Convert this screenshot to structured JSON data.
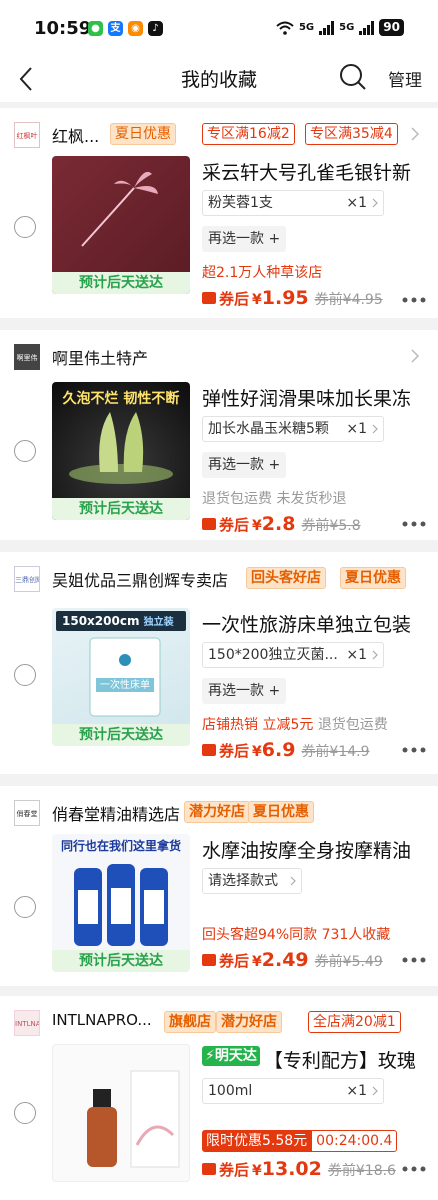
{
  "status": {
    "time": "10:59",
    "network1": "5G",
    "network2": "5G",
    "battery": "90"
  },
  "nav": {
    "title": "我的收藏",
    "manage": "管理"
  },
  "items": [
    {
      "shop": {
        "logo_text": "红枫叶",
        "name": "红枫...",
        "tags": [
          "夏日优惠",
          "专区满16减2",
          "专区满35减4"
        ]
      },
      "title": "采云轩大号孔雀毛银针新",
      "sku": "粉芙蓉1支",
      "qty": "×1",
      "again": "再选一款 +",
      "ship": "预计后天送达",
      "promo": "超2.1万人种草该店",
      "after_label": "券后",
      "yen": "¥",
      "price": "1.95",
      "before": "券前¥4.95"
    },
    {
      "shop": {
        "logo_text": "啊里伟",
        "name": "啊里伟土特产",
        "tags": []
      },
      "title": "弹性好润滑果味加长果冻",
      "image_text": "久泡不烂  韧性不断",
      "sku": "加长水晶玉米糖5颗",
      "qty": "×1",
      "again": "再选一款 +",
      "ship": "预计后天送达",
      "promo": "退货包运费  未发货秒退",
      "after_label": "券后",
      "yen": "¥",
      "price": "2.8",
      "before": "券前¥5.8"
    },
    {
      "shop": {
        "logo_text": "三鼎创辉",
        "name": "吴姐优品三鼎创辉专卖店",
        "tags": [
          "回头客好店",
          "夏日优惠"
        ]
      },
      "title": "一次性旅游床单独立包装",
      "image_text": "150x200cm",
      "image_text2": "独立装",
      "image_text3": "一次性床单",
      "sku": "150*200独立灭菌...",
      "qty": "×1",
      "again": "再选一款 +",
      "ship": "预计后天送达",
      "promo_red": "店铺热销  立减5元",
      "promo_gray": "退货包运费",
      "after_label": "券后",
      "yen": "¥",
      "price": "6.9",
      "before": "券前¥14.9"
    },
    {
      "shop": {
        "logo_text": "俏春堂",
        "name": "俏春堂精油精选店",
        "tags": [
          "潜力好店",
          "夏日优惠"
        ]
      },
      "title": "水摩油按摩全身按摩精油",
      "image_text": "同行也在我们这里拿货",
      "sku": "请选择款式",
      "ship": "预计后天送达",
      "promo": "回头客超94%同款  731人收藏",
      "after_label": "券后",
      "yen": "¥",
      "price": "2.49",
      "before": "券前¥5.49"
    },
    {
      "shop": {
        "logo_text": "INTLNA",
        "name": "INTLNAPRO...",
        "tags": [
          "旗舰店",
          "潜力好店",
          "全店满20减1"
        ]
      },
      "flash": "明天达",
      "title": "【专利配方】玫瑰",
      "sku": "100ml",
      "qty": "×1",
      "limit_a": "限时优惠5.58元",
      "limit_b": "00:24:00.4",
      "after_label": "券后",
      "yen": "¥",
      "price": "13.02",
      "before": "券前¥18.6"
    }
  ],
  "colors": {
    "accent": "#e4380f",
    "ship_green": "#2aa14d",
    "tag_orange": "#e55f00"
  }
}
